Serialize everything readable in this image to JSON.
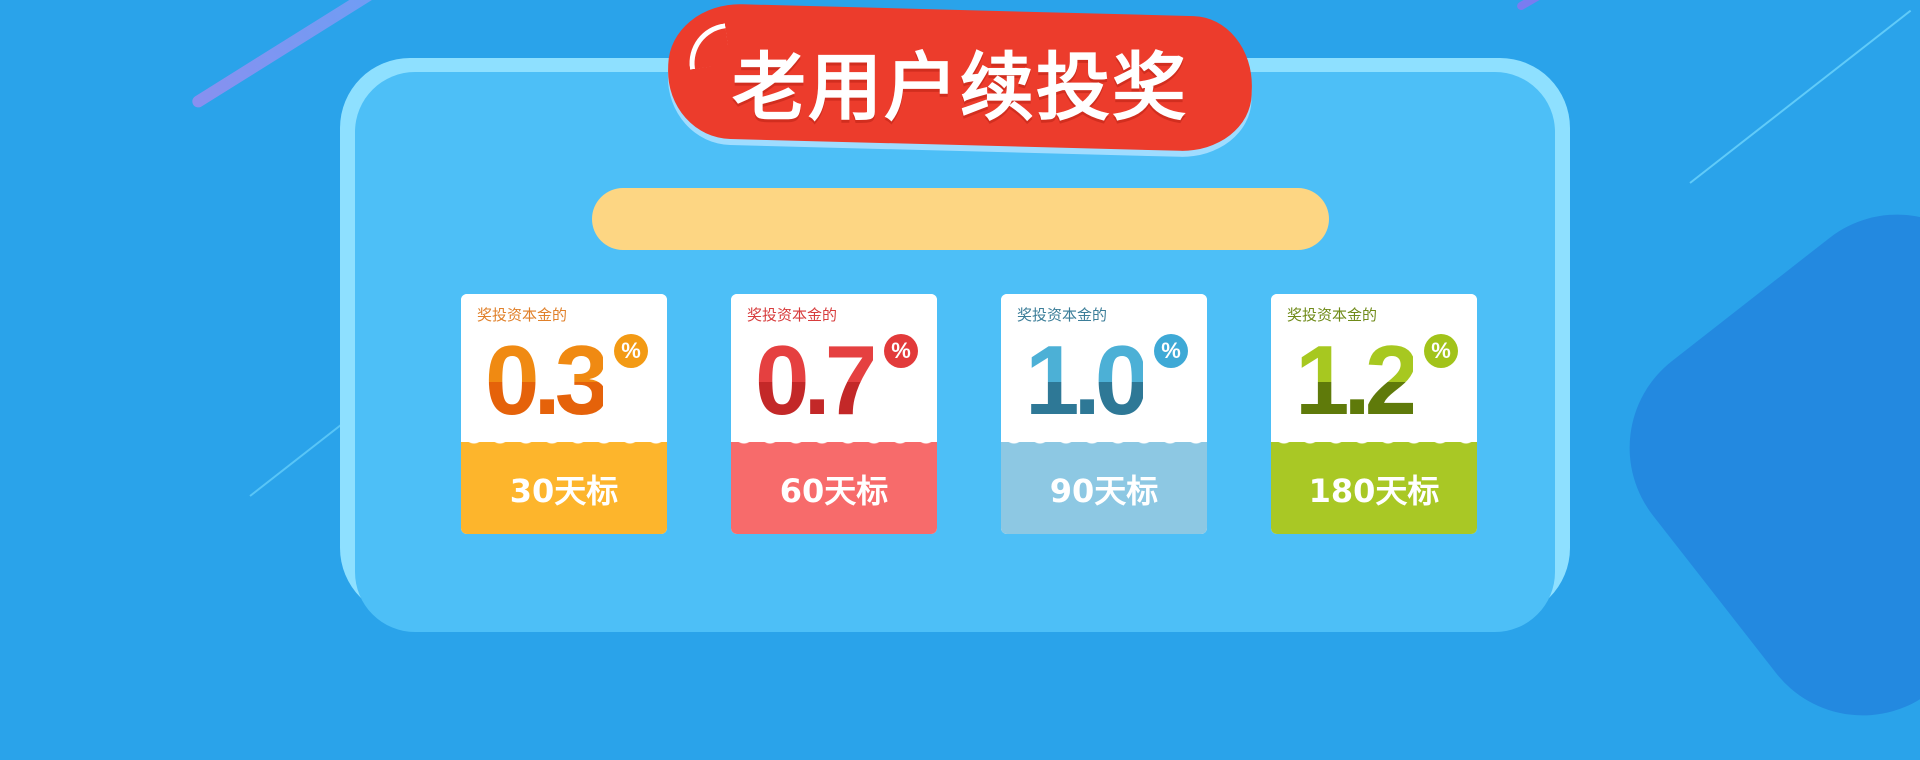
{
  "banner": {
    "title": "老用户续投奖"
  },
  "cards": [
    {
      "caption": "奖投资本金的",
      "rate": "0.3",
      "percent": "%",
      "term": "30天标",
      "colors": {
        "caption": "#e0802a",
        "rate_top": "#f08a12",
        "rate_bottom": "#e5620a",
        "badge": "#f39a14",
        "footer": "#fdb52c"
      }
    },
    {
      "caption": "奖投资本金的",
      "rate": "0.7",
      "percent": "%",
      "term": "60天标",
      "colors": {
        "caption": "#d73c3c",
        "rate_top": "#e54040",
        "rate_bottom": "#c32828",
        "badge": "#e23a3a",
        "footer": "#f76b6b"
      }
    },
    {
      "caption": "奖投资本金的",
      "rate": "1.0",
      "percent": "%",
      "term": "90天标",
      "colors": {
        "caption": "#3b7d98",
        "rate_top": "#4cb0d6",
        "rate_bottom": "#2e7896",
        "badge": "#3ea9d6",
        "footer": "#8dc8e3"
      }
    },
    {
      "caption": "奖投资本金的",
      "rate": "1.2",
      "percent": "%",
      "term": "180天标",
      "colors": {
        "caption": "#6f8a18",
        "rate_top": "#a7c820",
        "rate_bottom": "#5f7a0a",
        "badge": "#a2c31a",
        "footer": "#a9c825"
      }
    }
  ],
  "palette": {
    "background": "#2aa3ea",
    "panel": "#4dbff7",
    "panel_border": "#8ee0ff",
    "banner": "#ec3c2c",
    "strip": "#fdd683"
  }
}
